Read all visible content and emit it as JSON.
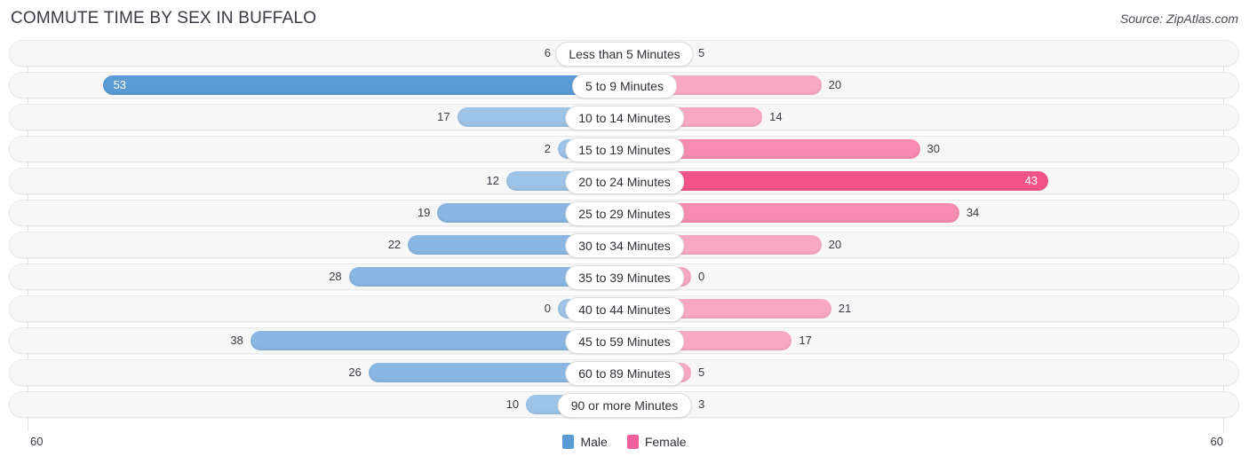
{
  "header": {
    "title": "COMMUTE TIME BY SEX IN BUFFALO",
    "source": "Source: ZipAtlas.com"
  },
  "axis": {
    "left_label": "60",
    "right_label": "60",
    "max": 60
  },
  "legend": {
    "items": [
      {
        "label": "Male",
        "color": "#5b9bd5"
      },
      {
        "label": "Female",
        "color": "#f2609b"
      }
    ]
  },
  "colors": {
    "male_light": "#9dc3e6",
    "male_mid": "#8ab6e3",
    "male_dark": "#5b9bd5",
    "female_light": "#f9a8c4",
    "female_mid": "#f78cb2",
    "female_dark": "#f2548a",
    "track": "#f7f7f7",
    "gridline": "#e2e2e2"
  },
  "chart_data": {
    "type": "bar",
    "title": "COMMUTE TIME BY SEX IN BUFFALO",
    "subtype": "diverging-bidirectional",
    "xlabel": "",
    "ylabel": "",
    "xlim": [
      60,
      60
    ],
    "grid": true,
    "legend_position": "bottom-center",
    "categories": [
      "Less than 5 Minutes",
      "5 to 9 Minutes",
      "10 to 14 Minutes",
      "15 to 19 Minutes",
      "20 to 24 Minutes",
      "25 to 29 Minutes",
      "30 to 34 Minutes",
      "35 to 39 Minutes",
      "40 to 44 Minutes",
      "45 to 59 Minutes",
      "60 to 89 Minutes",
      "90 or more Minutes"
    ],
    "series": [
      {
        "name": "Male",
        "values": [
          6,
          53,
          17,
          2,
          12,
          19,
          22,
          28,
          0,
          38,
          26,
          10
        ]
      },
      {
        "name": "Female",
        "values": [
          5,
          20,
          14,
          30,
          43,
          34,
          20,
          0,
          21,
          17,
          5,
          3
        ]
      }
    ]
  },
  "rows": [
    {
      "category": "Less than 5 Minutes",
      "male": 6,
      "female": 5
    },
    {
      "category": "5 to 9 Minutes",
      "male": 53,
      "female": 20
    },
    {
      "category": "10 to 14 Minutes",
      "male": 17,
      "female": 14
    },
    {
      "category": "15 to 19 Minutes",
      "male": 2,
      "female": 30
    },
    {
      "category": "20 to 24 Minutes",
      "male": 12,
      "female": 43
    },
    {
      "category": "25 to 29 Minutes",
      "male": 19,
      "female": 34
    },
    {
      "category": "30 to 34 Minutes",
      "male": 22,
      "female": 20
    },
    {
      "category": "35 to 39 Minutes",
      "male": 28,
      "female": 0
    },
    {
      "category": "40 to 44 Minutes",
      "male": 0,
      "female": 21
    },
    {
      "category": "45 to 59 Minutes",
      "male": 38,
      "female": 17
    },
    {
      "category": "60 to 89 Minutes",
      "male": 26,
      "female": 5
    },
    {
      "category": "90 or more Minutes",
      "male": 10,
      "female": 3
    }
  ]
}
